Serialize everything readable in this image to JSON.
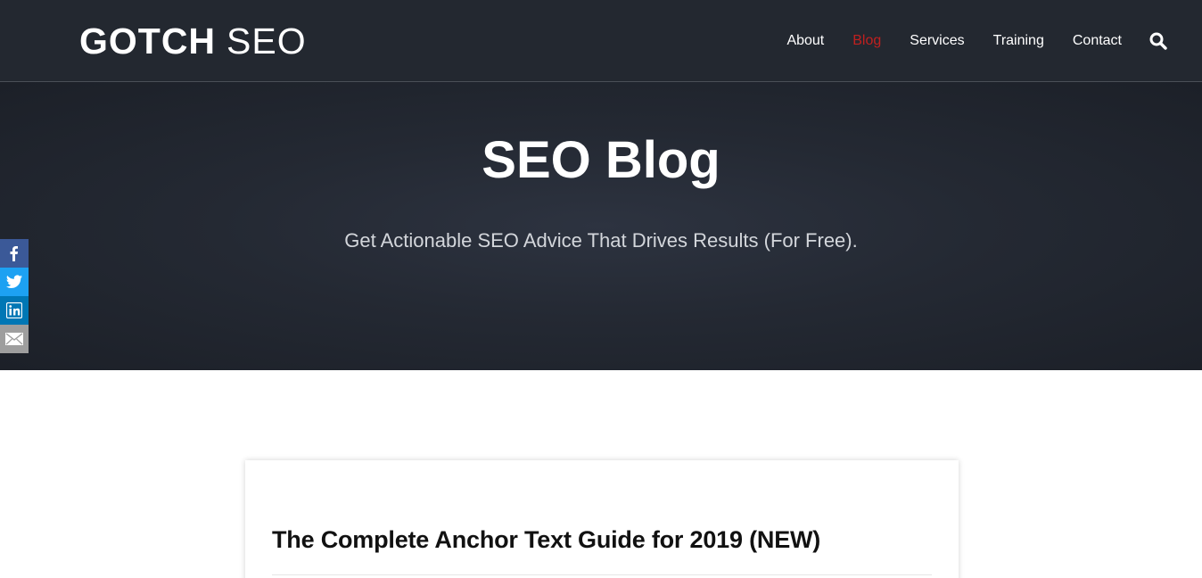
{
  "header": {
    "logo": {
      "bold": "GOTCH",
      "light": "SEO"
    },
    "nav": [
      {
        "label": "About",
        "active": false
      },
      {
        "label": "Blog",
        "active": true
      },
      {
        "label": "Services",
        "active": false
      },
      {
        "label": "Training",
        "active": false
      },
      {
        "label": "Contact",
        "active": false
      }
    ],
    "search_icon": "search-icon"
  },
  "hero": {
    "title": "SEO Blog",
    "subtitle": "Get Actionable SEO Advice That Drives Results (For Free)."
  },
  "share_bar": [
    {
      "icon": "facebook-icon",
      "color": "#3b5998"
    },
    {
      "icon": "twitter-icon",
      "color": "#1da1f2"
    },
    {
      "icon": "linkedin-icon",
      "color": "#0077b5"
    },
    {
      "icon": "email-icon",
      "color": "#9e9e9e"
    }
  ],
  "post": {
    "title": "The Complete Anchor Text Guide for 2019 (NEW)"
  },
  "colors": {
    "header_bg": "#232830",
    "accent_active": "#c0201f",
    "hero_bg": "#242933"
  }
}
